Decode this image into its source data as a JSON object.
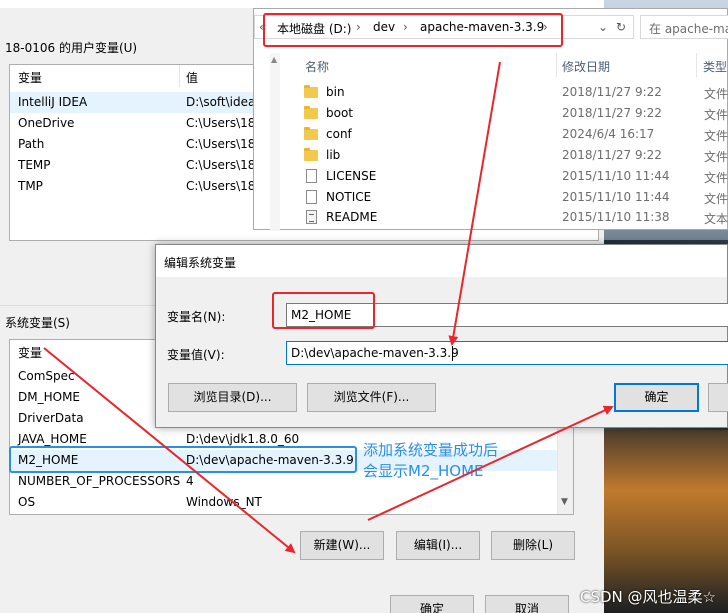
{
  "user_vars": {
    "heading": "18-0106 的用户变量(U)",
    "col_var": "变量",
    "col_val": "值",
    "rows": [
      {
        "name": "IntelliJ IDEA",
        "value": "D:\\soft\\idea"
      },
      {
        "name": "OneDrive",
        "value": "C:\\Users\\18"
      },
      {
        "name": "Path",
        "value": "C:\\Users\\18"
      },
      {
        "name": "TEMP",
        "value": "C:\\Users\\18"
      },
      {
        "name": "TMP",
        "value": "C:\\Users\\18"
      }
    ]
  },
  "system_vars": {
    "heading": "系统变量(S)",
    "col_var": "变量",
    "rows": [
      {
        "name": "ComSpec",
        "value": ""
      },
      {
        "name": "DM_HOME",
        "value": ""
      },
      {
        "name": "DriverData",
        "value": ""
      },
      {
        "name": "JAVA_HOME",
        "value": "D:\\dev\\jdk1.8.0_60"
      },
      {
        "name": "M2_HOME",
        "value": "D:\\dev\\apache-maven-3.3.9"
      },
      {
        "name": "NUMBER_OF_PROCESSORS",
        "value": "4"
      },
      {
        "name": "OS",
        "value": "Windows_NT"
      }
    ],
    "new_label": "新建(W)...",
    "edit_label": "编辑(I)...",
    "delete_label": "删除(L)"
  },
  "footer": {
    "ok_label": "确定",
    "cancel_label": "取消"
  },
  "explorer": {
    "breadcrumb": [
      "本地磁盘 (D:)",
      "dev",
      "apache-maven-3.3.9"
    ],
    "search_placeholder": "在 apache-ma",
    "col_name": "名称",
    "col_date": "修改日期",
    "col_type": "类型",
    "files": [
      {
        "name": "bin",
        "date": "2018/11/27 9:22",
        "type": "文件",
        "kind": "folder"
      },
      {
        "name": "boot",
        "date": "2018/11/27 9:22",
        "type": "文件",
        "kind": "folder"
      },
      {
        "name": "conf",
        "date": "2024/6/4 16:17",
        "type": "文件",
        "kind": "folder"
      },
      {
        "name": "lib",
        "date": "2018/11/27 9:22",
        "type": "文件",
        "kind": "folder"
      },
      {
        "name": "LICENSE",
        "date": "2015/11/10 11:44",
        "type": "文件",
        "kind": "file"
      },
      {
        "name": "NOTICE",
        "date": "2015/11/10 11:44",
        "type": "文件",
        "kind": "file"
      },
      {
        "name": "README",
        "date": "2015/11/10 11:38",
        "type": "文本",
        "kind": "text"
      }
    ]
  },
  "dialog": {
    "title": "编辑系统变量",
    "name_label": "变量名(N):",
    "name_value": "M2_HOME",
    "value_label": "变量值(V):",
    "value_value": "D:\\dev\\apache-maven-3.3.9",
    "browse_dir_label": "浏览目录(D)...",
    "browse_file_label": "浏览文件(F)...",
    "ok_label": "确定"
  },
  "annotation": {
    "line1": "添加系统变量成功后",
    "line2": "会显示M2_HOME"
  },
  "watermark": "CSDN @风也温柔☆",
  "colors": {
    "annotation_red": "#e8262b",
    "annotation_blue": "#2b8fe3",
    "focus_blue": "#0078d7"
  }
}
